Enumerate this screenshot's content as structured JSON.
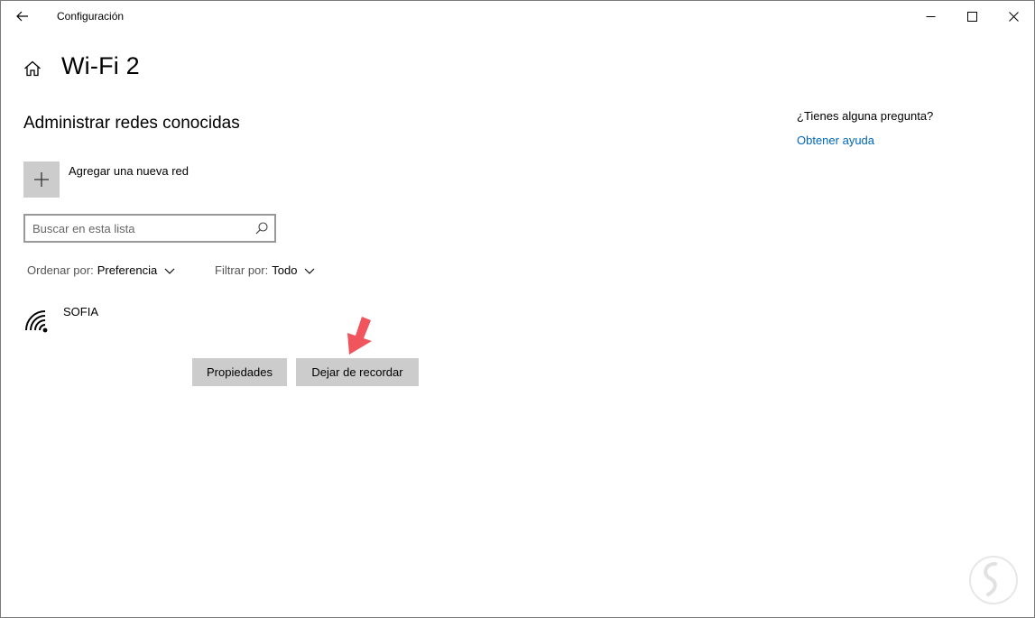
{
  "window": {
    "title": "Configuración",
    "controls": {
      "minimize": "minimize-icon",
      "maximize": "maximize-icon",
      "close": "close-icon"
    }
  },
  "header": {
    "title": "Wi-Fi 2"
  },
  "main": {
    "section_title": "Administrar redes conocidas",
    "add_network_label": "Agregar una nueva red",
    "search": {
      "placeholder": "Buscar en esta lista",
      "value": ""
    },
    "sort": {
      "label": "Ordenar por:",
      "value": "Preferencia"
    },
    "filter": {
      "label": "Filtrar por:",
      "value": "Todo"
    },
    "networks": [
      {
        "name": "SOFIA",
        "buttons": {
          "properties": "Propiedades",
          "forget": "Dejar de recordar"
        }
      }
    ]
  },
  "help": {
    "question": "¿Tienes alguna pregunta?",
    "link": "Obtener ayuda"
  },
  "colors": {
    "accent_link": "#0067b8",
    "button_bg": "#cccccc",
    "annotation_arrow": "#f0555e"
  }
}
